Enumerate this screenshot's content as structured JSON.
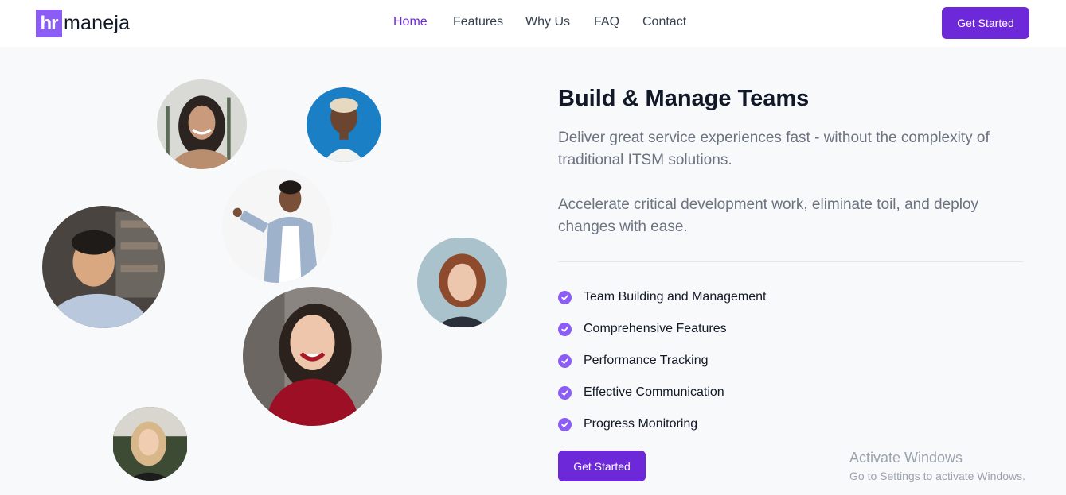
{
  "header": {
    "logo_mark": "hr",
    "logo_text": "maneja",
    "nav": [
      {
        "label": "Home",
        "active": true
      },
      {
        "label": "Features",
        "active": false
      },
      {
        "label": "Why Us",
        "active": false
      },
      {
        "label": "FAQ",
        "active": false
      },
      {
        "label": "Contact",
        "active": false
      }
    ],
    "cta_label": "Get Started"
  },
  "hero": {
    "title": "Build & Manage Teams",
    "description_1": "Deliver great service experiences fast - without the complexity of traditional ITSM solutions.",
    "description_2": "Accelerate critical development work, eliminate toil, and deploy changes with ease.",
    "features": [
      "Team Building and Management",
      "Comprehensive Features",
      "Performance Tracking",
      "Effective Communication",
      "Progress Monitoring"
    ],
    "cta_label": "Get Started"
  },
  "watermark": {
    "line1": "Activate Windows",
    "line2": "Go to Settings to activate Windows."
  },
  "colors": {
    "brand": "#6d28d9",
    "logo_accent": "#8b5cf6",
    "check": "#8b5cf6",
    "page_bg": "#f8f9fb"
  },
  "icons": [
    "check-circle-icon"
  ]
}
